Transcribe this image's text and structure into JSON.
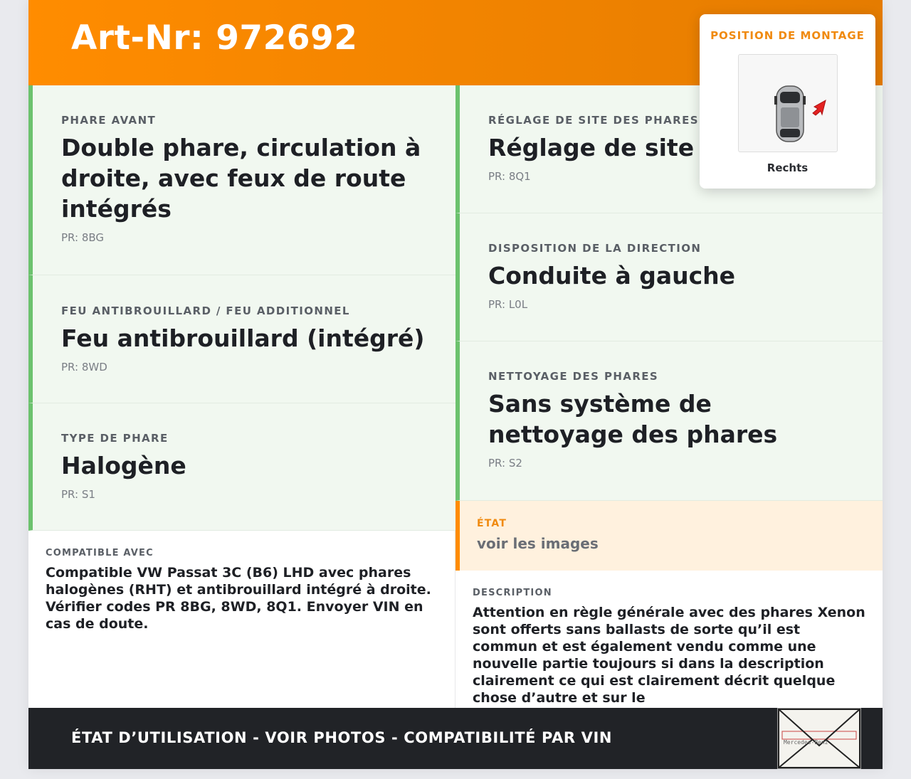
{
  "header": {
    "art_nr": "Art-Nr: 972692"
  },
  "left_cards": [
    {
      "label": "PHARE AVANT",
      "value": "Double phare, circulation à droite, avec feux de route intégrés",
      "pr": "PR: 8BG"
    },
    {
      "label": "FEU ANTIBROUILLARD / FEU ADDITIONNEL",
      "value": "Feu antibrouillard (intégré)",
      "pr": "PR: 8WD"
    },
    {
      "label": "TYPE DE PHARE",
      "value": "Halogène",
      "pr": "PR: S1"
    }
  ],
  "right_cards": [
    {
      "label": "RÉGLAGE DE SITE DES PHARES",
      "value": "Réglage de site d",
      "pr": "PR: 8Q1"
    },
    {
      "label": "DISPOSITION DE LA DIRECTION",
      "value": "Conduite à gauche",
      "pr": "PR: L0L"
    },
    {
      "label": "NETTOYAGE DES PHARES",
      "value": "Sans système de nettoyage des phares",
      "pr": "PR: S2"
    }
  ],
  "compatible": {
    "label": "COMPATIBLE AVEC",
    "text": "Compatible VW Passat 3C (B6) LHD avec phares halogènes (RHT) et antibrouillard intégré à droite. Vérifier codes PR 8BG, 8WD, 8Q1. Envoyer VIN en cas de doute."
  },
  "etat": {
    "label": "ÉTAT",
    "text": "voir les images"
  },
  "description": {
    "label": "DESCRIPTION",
    "text": "Attention en règle générale avec des phares Xenon sont offerts sans ballasts de sorte qu’il est commun et est également vendu comme une nouvelle partie toujours si dans la description clairement ce qui est clairement décrit quelque chose d’autre et sur le"
  },
  "footer": {
    "text": "ÉTAT D’UTILISATION - VOIR PHOTOS - COMPATIBILITÉ PAR VIN",
    "stamp_text": "Mercedes-Benz"
  },
  "popup": {
    "title": "POSITION DE MONTAGE",
    "side": "Rechts"
  },
  "colors": {
    "orange": "#ff8c00",
    "green_border": "#6cc26e",
    "dark": "#212327"
  }
}
